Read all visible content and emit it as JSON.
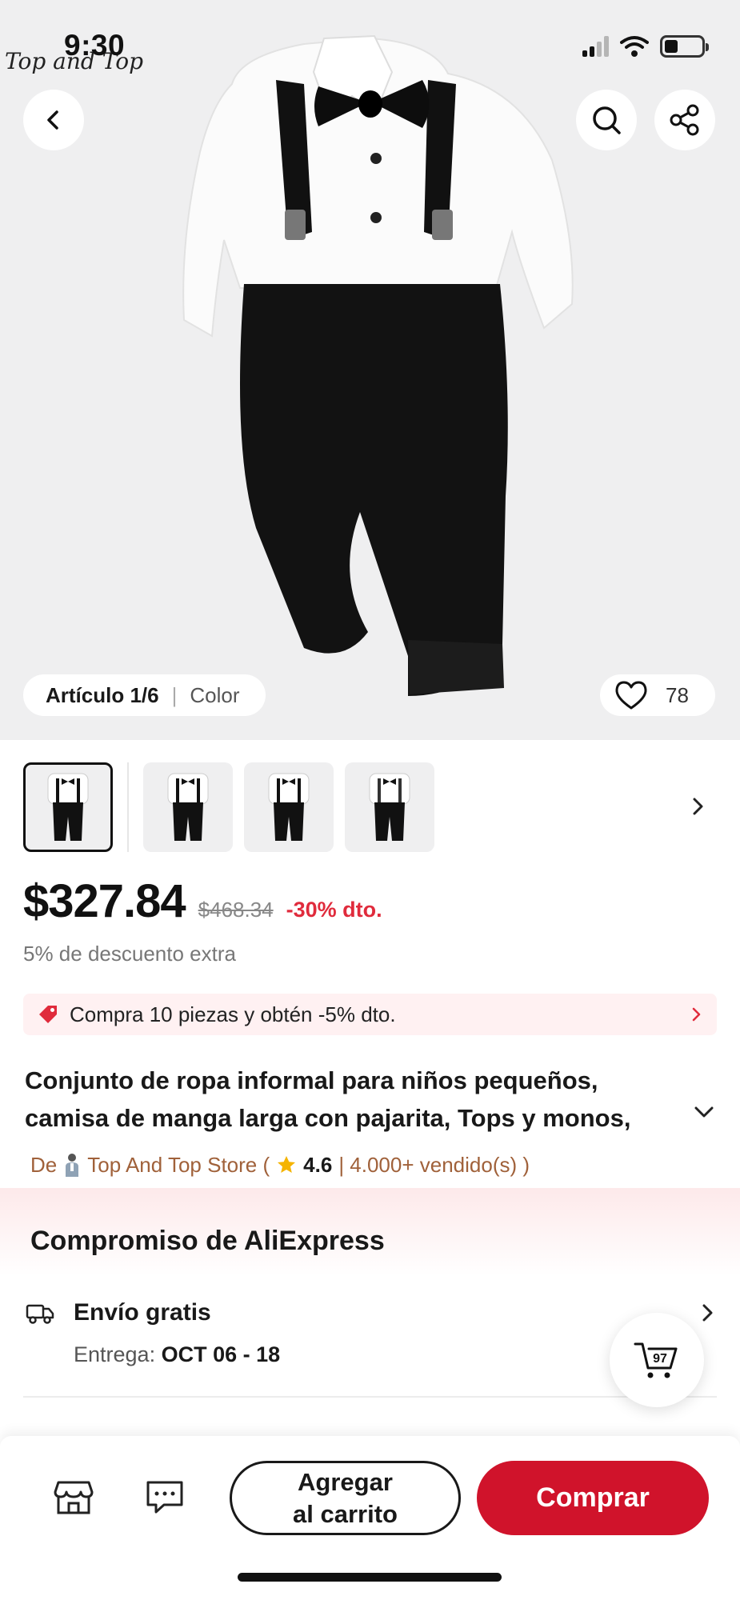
{
  "status_bar": {
    "time": "9:30",
    "brand_watermark": "Top and Top"
  },
  "gallery": {
    "counter": "Artículo 1/6",
    "variant_label": "Color",
    "favorites": "78"
  },
  "price": {
    "current": "$327.84",
    "original": "$468.34",
    "discount": "-30% dto.",
    "extra": "5% de descuento extra"
  },
  "promo": {
    "text": "Compra 10 piezas y obtén -5% dto."
  },
  "product": {
    "title_line1": "Conjunto de ropa informal para niños pequeños,",
    "title_line2": "camisa de manga larga con pajarita, Tops y monos,"
  },
  "store": {
    "prefix": "De",
    "name": "Top And Top Store (",
    "rating": "4.6",
    "sold": "| 4.000+ vendido(s) )"
  },
  "commitment": {
    "title": "Compromiso de AliExpress",
    "shipping_title": "Envío gratis",
    "delivery_label": "Entrega:",
    "delivery_dates": "OCT 06 - 18"
  },
  "cart": {
    "count": "97"
  },
  "actions": {
    "add_to_cart_line1": "Agregar",
    "add_to_cart_line2": "al carrito",
    "buy": "Comprar"
  },
  "colors": {
    "accent": "#d0132b",
    "discount": "#e02b3c",
    "store": "#a0613a",
    "promo_bg": "#fff1f2"
  },
  "icons": [
    "back-arrow-icon",
    "search-icon",
    "share-icon",
    "heart-icon",
    "chevron-right-icon",
    "tag-icon",
    "chevron-down-icon",
    "star-icon",
    "truck-icon",
    "cart-icon",
    "store-icon",
    "chat-icon"
  ]
}
